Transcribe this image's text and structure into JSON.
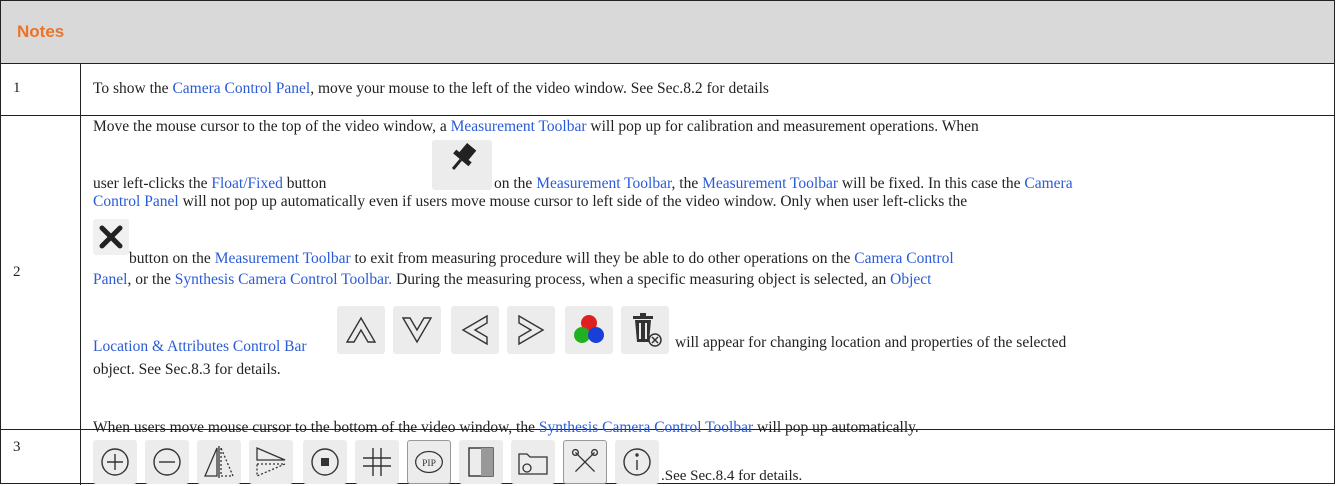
{
  "header": {
    "title": "Notes"
  },
  "rows": [
    {
      "num": "1",
      "t1": "To show the ",
      "l1": "Camera Control Panel",
      "t2": ", move your mouse to the left of the video window. See Sec.8.2 for details"
    },
    {
      "num": "2",
      "a1": "Move the mouse cursor to the top of the video window, a ",
      "a2": "Measurement Toolbar",
      "a3": " will pop up for calibration and measurement operations. When",
      "b1": "user left-clicks the ",
      "b2": "Float/Fixed",
      "b3": " button",
      "b4": " on the ",
      "b5": "Measurement Toolbar",
      "b6": ", the ",
      "b7": "Measurement Toolbar",
      "b8": " will be fixed. In this case the ",
      "b9": "Camera",
      "c1": "Control Panel",
      "c2": " will not pop up automatically even if users move mouse cursor to left side of the video window. Only when user left-clicks the",
      "d1": " button on the ",
      "d2": "Measurement Toolbar",
      "d3": " to exit from measuring procedure will they be able to do other operations on the ",
      "d4": "Camera Control",
      "e1": "Panel",
      "e2": ", or the ",
      "e3": "Synthesis Camera Control Toolbar.",
      "e4": " During the measuring process, when a specific measuring object is selected, an ",
      "e5": "Object",
      "f1": "Location & Attributes Control Bar",
      "f2": " will appear for changing location and properties of the selected",
      "g1": "object. See Sec.8.3 for details."
    },
    {
      "num": "3",
      "h1": "When users move mouse cursor to the bottom of the video window, the ",
      "h2": "Synthesis Camera Control Toolbar",
      "h3": " will pop up automatically.",
      "i1": ".See Sec.8.4 for details."
    }
  ],
  "icons": {
    "measure_toolbar": [
      "pin-icon",
      "close-icon"
    ],
    "object_bar": [
      "move-up-icon",
      "move-down-icon",
      "move-left-icon",
      "move-right-icon",
      "color-icon",
      "delete-icon"
    ],
    "synthesis_toolbar": [
      "zoom-in-icon",
      "zoom-out-icon",
      "horizontal-flip-icon",
      "vertical-flip-icon",
      "record-icon",
      "grid-icon",
      "pip-icon",
      "compare-icon",
      "browse-folder-icon",
      "settings-icon",
      "about-icon"
    ]
  },
  "colors": {
    "link": "#2a5bd7",
    "header_text": "#e8742a",
    "header_bg": "#d9d9d9"
  }
}
